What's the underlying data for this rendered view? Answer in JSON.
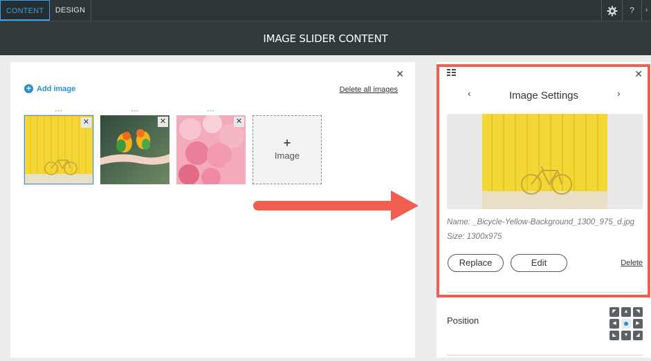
{
  "tabs": [
    {
      "label": "CONTENT",
      "active": true
    },
    {
      "label": "DESIGN",
      "active": false
    }
  ],
  "top_icons": [
    "gear-icon",
    "help-icon",
    "chevron-icon"
  ],
  "header": {
    "title": "IMAGE SLIDER CONTENT"
  },
  "gallery": {
    "add_label": "Add image",
    "delete_all_label": "Delete all images",
    "images": [
      {
        "name": "bicycle-yellow",
        "selected": true
      },
      {
        "name": "parrots-on-hand",
        "selected": false
      },
      {
        "name": "pink-balloons",
        "selected": false
      }
    ],
    "add_tile_plus": "+",
    "add_tile_label": "Image"
  },
  "settings": {
    "title": "Image Settings",
    "name_text": "Name: _Bicycle-Yellow-Background_1300_975_d.jpg",
    "size_text": "Size: 1300x975",
    "replace_label": "Replace",
    "edit_label": "Edit",
    "delete_label": "Delete",
    "position_label": "Position"
  },
  "colors": {
    "accent": "#2a8fcf",
    "highlight": "#ef5e4e",
    "header": "#30393c"
  }
}
